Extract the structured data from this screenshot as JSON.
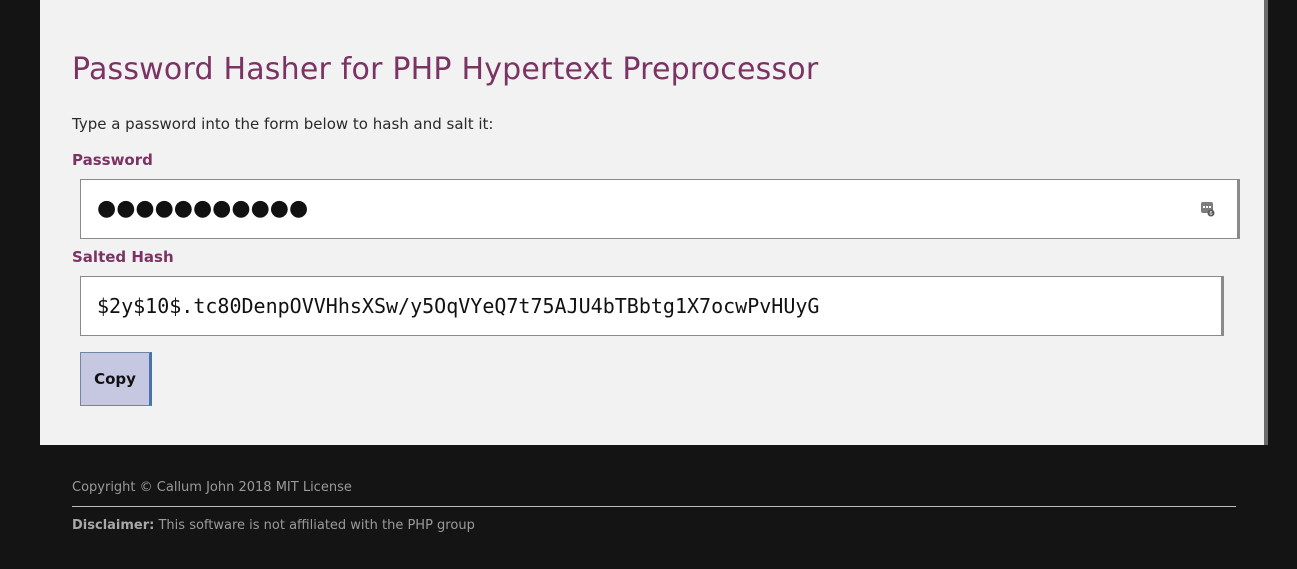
{
  "header": {
    "title": "Password Hasher for PHP Hypertext Preprocessor",
    "intro": "Type a password into the form below to hash and salt it:"
  },
  "password_field": {
    "label": "Password",
    "masked_value": "●●●●●●●●●●●",
    "manager_icon": "password-manager-icon"
  },
  "hash_field": {
    "label": "Salted Hash",
    "value": "$2y$10$.tc80DenpOVVHhsXSw/y5OqVYeQ7t75AJU4bTBbtg1X7ocwPvHUyG"
  },
  "copy_button": {
    "label": "Copy"
  },
  "footer": {
    "copyright": "Copyright © Callum John 2018 MIT License",
    "disclaimer_label": "Disclaimer:",
    "disclaimer_text": " This software is not affiliated with the PHP group"
  },
  "colors": {
    "accent": "#7b3364",
    "button_bg": "#c5c8e0",
    "page_bg": "#141414",
    "card_bg": "#f2f2f2"
  }
}
